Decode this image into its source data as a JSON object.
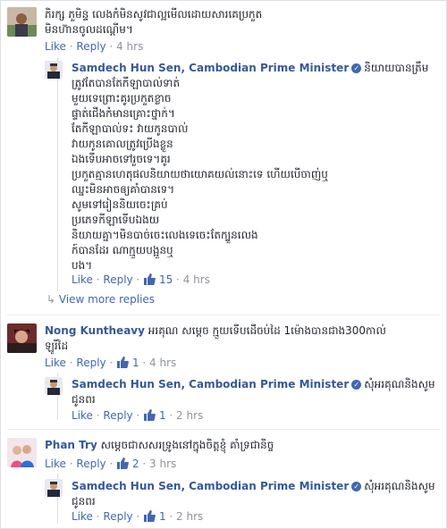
{
  "comments": [
    {
      "author": "",
      "text_lines": [
        "ភិរក្ស ភួមិន្ទ លេងកំមិនសូវជាល្អមើលដោយសារគេប្រកួត",
        "មិនហ៊ានចូលដណ្តើម។"
      ],
      "like_label": "Like",
      "reply_label": "Reply",
      "time": "4 hrs",
      "replies": [
        {
          "author": "Samdech Hun Sen, Cambodian Prime Minister",
          "text_lines": [
            "និយាយបានត្រឹម",
            "ត្រូវតែបានតែកីឡាបាល់ទាត់",
            "មួយទេព្រោះគូរប្រកួតខ្លាច",
            "ផ្ទាត់ជើងកំមានគ្រោះថ្នាក់។",
            "តែកីឡាបាល់ទះ វាយកូនបាល់",
            "វាយកូនគោលត្រូវប្រើងខ្លួន",
            "ឯងទើបអាចទៅរួចទេ។គូរ",
            "ប្រកួតគ្មានហេតុផលនិយាយថាយោគយល់នោះទេ ហើយបើចាញ់ឬ",
            "ឈ្នះមិនអាចឲ្យគាំបានទេ។",
            "សូមទៅរៀននិយចេះគ្រប់",
            "ប្រភេទកីឡាទើបឯងយ",
            "និយាយគ្នា។មិនបាច់ចេះលេងទេចេះតែក្បួនលេង",
            "ក៍បានដែរ ណាក្មួយបង្អួនឬ",
            "បង។"
          ],
          "like_label": "Like",
          "reply_label": "Reply",
          "likes": "15",
          "time": "4 hrs"
        }
      ],
      "view_more": "View more replies"
    },
    {
      "author": "Nong Kuntheavy",
      "text_lines": [
        "អរគុណ សម្តេច ក្មួយទើបដើចប់ដៃ 1ម៉ោងបានជាង300កាល់",
        "ឡូរីដៃ"
      ],
      "like_label": "Like",
      "reply_label": "Reply",
      "likes": "1",
      "time": "4 hrs",
      "replies": [
        {
          "author": "Samdech Hun Sen, Cambodian Prime Minister",
          "text_lines": [
            "សុំអរគុណនិងសូម",
            "ជូនពរ"
          ],
          "like_label": "Like",
          "reply_label": "Reply",
          "likes": "1",
          "time": "2 hrs"
        }
      ]
    },
    {
      "author": "Phan Try",
      "text_lines": [
        "សម្តេចជាសសរទ្រូងនៅក្នុងចិត្តខ្ញុំ គាំទ្រជានិច្ច"
      ],
      "like_label": "Like",
      "reply_label": "Reply",
      "likes": "2",
      "time": "3 hrs",
      "replies": [
        {
          "author": "Samdech Hun Sen, Cambodian Prime Minister",
          "text_lines": [
            "សុំអរគុណនិងសូម",
            "ជូនពរ"
          ],
          "like_label": "Like",
          "reply_label": "Reply",
          "likes": "1",
          "time": "2 hrs"
        }
      ]
    }
  ],
  "colors": {
    "link": "#4267b2",
    "name": "#365899",
    "meta": "#90949c",
    "text": "#1d2129"
  },
  "icons": {
    "like": "thumbs-up-icon",
    "verified": "verified-badge-icon",
    "view_more": "reply-arrow-icon"
  }
}
